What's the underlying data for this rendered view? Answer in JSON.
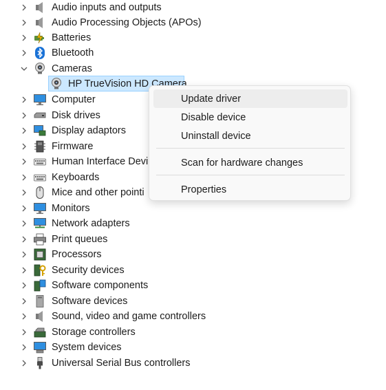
{
  "tree": {
    "items": [
      {
        "label": "Audio inputs and outputs",
        "icon": "speaker-icon",
        "expanded": false
      },
      {
        "label": "Audio Processing Objects (APOs)",
        "icon": "speaker-icon",
        "expanded": false
      },
      {
        "label": "Batteries",
        "icon": "battery-icon",
        "expanded": false
      },
      {
        "label": "Bluetooth",
        "icon": "bluetooth-icon",
        "expanded": false
      },
      {
        "label": "Cameras",
        "icon": "camera-icon",
        "expanded": true
      },
      {
        "label": "Computer",
        "icon": "monitor-icon",
        "expanded": false
      },
      {
        "label": "Disk drives",
        "icon": "disk-drive-icon",
        "expanded": false
      },
      {
        "label": "Display adaptors",
        "icon": "display-adapter-icon",
        "expanded": false
      },
      {
        "label": "Firmware",
        "icon": "firmware-icon",
        "expanded": false
      },
      {
        "label": "Human Interface Devi",
        "icon": "keyboard-icon",
        "expanded": false
      },
      {
        "label": "Keyboards",
        "icon": "keyboard-icon",
        "expanded": false
      },
      {
        "label": "Mice and other pointi",
        "icon": "mouse-icon",
        "expanded": false
      },
      {
        "label": "Monitors",
        "icon": "monitor-icon",
        "expanded": false
      },
      {
        "label": "Network adapters",
        "icon": "network-icon",
        "expanded": false
      },
      {
        "label": "Print queues",
        "icon": "printer-icon",
        "expanded": false
      },
      {
        "label": "Processors",
        "icon": "processor-icon",
        "expanded": false
      },
      {
        "label": "Security devices",
        "icon": "security-key-icon",
        "expanded": false
      },
      {
        "label": "Software components",
        "icon": "software-component-icon",
        "expanded": false
      },
      {
        "label": "Software devices",
        "icon": "software-device-icon",
        "expanded": false
      },
      {
        "label": "Sound, video and game controllers",
        "icon": "speaker-icon",
        "expanded": false
      },
      {
        "label": "Storage controllers",
        "icon": "storage-controller-icon",
        "expanded": false
      },
      {
        "label": "System devices",
        "icon": "system-device-icon",
        "expanded": false
      },
      {
        "label": "Universal Serial Bus controllers",
        "icon": "usb-icon",
        "expanded": false
      }
    ],
    "camera_child": {
      "label": "HP TrueVision HD Camera",
      "icon": "camera-icon",
      "selected": true
    }
  },
  "context_menu": {
    "items": [
      {
        "label": "Update driver",
        "hover": true
      },
      {
        "label": "Disable device",
        "hover": false
      },
      {
        "label": "Uninstall device",
        "hover": false
      },
      {
        "label": "Scan for hardware changes",
        "hover": false
      },
      {
        "label": "Properties",
        "hover": false
      }
    ]
  },
  "colors": {
    "selection_bg": "#cce8ff",
    "selection_border": "#99d1ff",
    "menu_bg": "#f9f9f9",
    "menu_hover": "#ededed"
  }
}
